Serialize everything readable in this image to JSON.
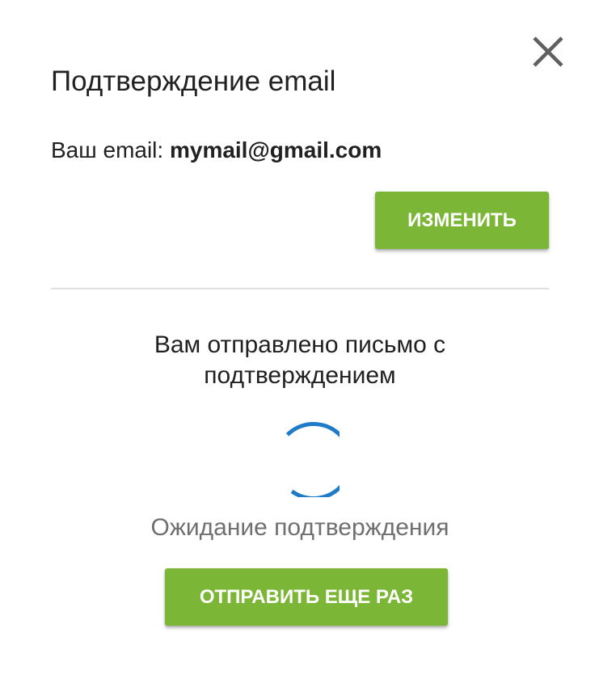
{
  "dialog": {
    "title": "Подтверждение email",
    "email_label": "Ваш email: ",
    "email_value": "mymail@gmail.com",
    "change_button": "ИЗМЕНИТЬ",
    "sent_message": "Вам отправлено письмо с подтверждением",
    "waiting_status": "Ожидание подтверждения",
    "resend_button": "ОТПРАВИТЬ ЕЩЕ РАЗ",
    "close_icon": "close-icon"
  },
  "colors": {
    "accent_button": "#7cb636",
    "spinner": "#1e7bc8",
    "text_primary": "#212121",
    "text_secondary": "#6f6f6f",
    "divider": "#e0e0e0",
    "close_icon": "#5f5f5f"
  }
}
